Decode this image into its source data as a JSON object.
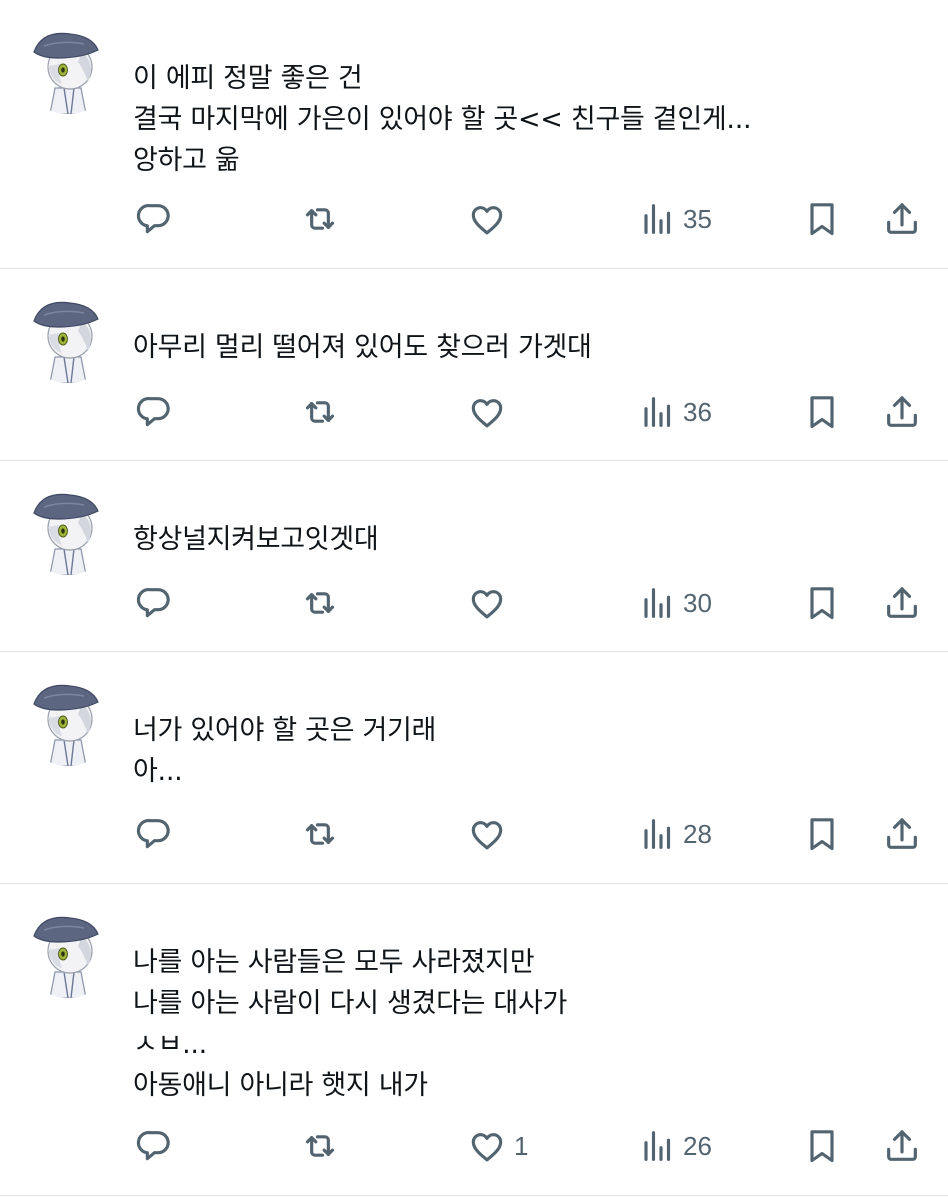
{
  "colors": {
    "text": "#0f1419",
    "icon": "#536471",
    "divider": "#e4e7ea",
    "background": "#ffffff"
  },
  "icons": [
    "reply-icon",
    "retweet-icon",
    "like-icon",
    "views-icon",
    "bookmark-icon",
    "share-icon"
  ],
  "posts": [
    {
      "lines": [
        "이 에피 정말 좋은 건",
        "결국 마지막에 가은이 있어야 할 곳<< 친구들 곁인게...",
        "앙하고 욺"
      ],
      "likes": "",
      "views": "35"
    },
    {
      "lines": [
        "아무리 멀리 떨어져 있어도 찾으러 가겟대"
      ],
      "likes": "",
      "views": "36"
    },
    {
      "lines": [
        "항상널지켜보고잇겟대"
      ],
      "likes": "",
      "views": "30"
    },
    {
      "lines": [
        "너가 있어야 할 곳은 거기래",
        "아..."
      ],
      "likes": "",
      "views": "28"
    },
    {
      "lines": [
        "나를 아는 사람들은 모두 사라졌지만",
        "나를 아는 사람이 다시 생겼다는 대사가",
        "ㅅㅂ...",
        "아동애니 아니라 햇지 내가"
      ],
      "likes": "1",
      "views": "26"
    }
  ]
}
